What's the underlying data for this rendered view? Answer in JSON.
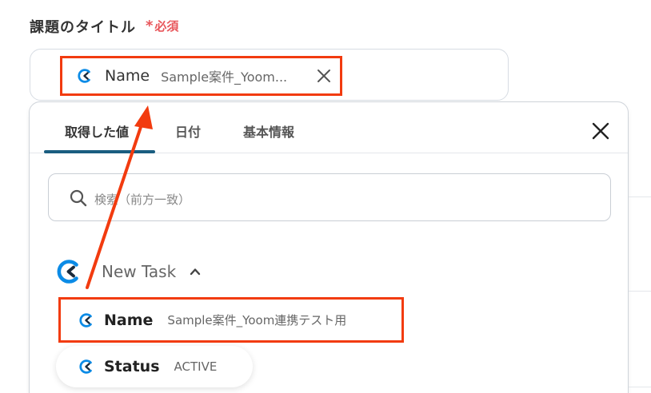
{
  "field": {
    "label": "課題のタイトル",
    "required_mark": "*",
    "required_text": "必須"
  },
  "selected_chip": {
    "key": "Name",
    "value": "Sample案件_Yoom..."
  },
  "panel": {
    "tabs": [
      {
        "label": "取得した値",
        "active": true
      },
      {
        "label": "日付",
        "active": false
      },
      {
        "label": "基本情報",
        "active": false
      }
    ],
    "search": {
      "placeholder": "検索（前方一致）"
    },
    "group": {
      "title": "New Task"
    },
    "items": [
      {
        "key": "Name",
        "value": "Sample案件_Yoom連携テスト用"
      },
      {
        "key": "Status",
        "value": "ACTIVE"
      }
    ]
  },
  "colors": {
    "highlight": "#f23b0f",
    "active_tab": "#1a5d80",
    "required": "#e8565b",
    "logo_blue": "#0b8be6",
    "logo_dark": "#1b2a3a"
  },
  "icons": [
    "clickup-logo-icon",
    "close-icon",
    "search-icon",
    "chevron-up-icon"
  ]
}
